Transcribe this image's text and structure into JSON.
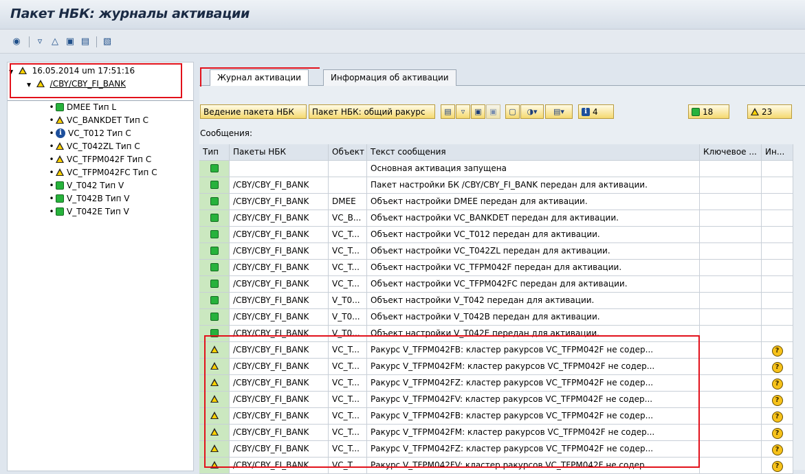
{
  "title": "Пакет НБК: журналы активации",
  "toolbar_icons": [
    "find-icon",
    "filter-icon",
    "collapse-icon",
    "expand-subtree-icon",
    "collapse-subtree-icon",
    "details-icon"
  ],
  "tree": {
    "root": "16.05.2014 um 17:51:16",
    "package": "/CBY/CBY_FI_BANK",
    "items": [
      {
        "label": "DMEE Тип L",
        "icon": "green-status-icon"
      },
      {
        "label": "VC_BANKDET Тип C",
        "icon": "warning-icon"
      },
      {
        "label": "VC_T012 Тип C",
        "icon": "info-icon"
      },
      {
        "label": "VC_T042ZL Тип C",
        "icon": "warning-icon"
      },
      {
        "label": "VC_TFPM042F Тип C",
        "icon": "warning-icon"
      },
      {
        "label": "VC_TFPM042FC Тип C",
        "icon": "warning-icon"
      },
      {
        "label": "V_T042 Тип V",
        "icon": "green-status-icon"
      },
      {
        "label": "V_T042B Тип V",
        "icon": "green-status-icon"
      },
      {
        "label": "V_T042E Тип V",
        "icon": "green-status-icon"
      }
    ]
  },
  "tabs": [
    "Журнал активации",
    "Информация об активации"
  ],
  "buttons": {
    "maintain": "Ведение пакета НБК",
    "overview": "Пакет НБК: общий ракурс",
    "info_count": "4",
    "success_count": "18",
    "warning_count": "23"
  },
  "messages_label": "Сообщения:",
  "columns": [
    "Тип",
    "Пакеты НБК",
    "Объект",
    "Текст сообщения",
    "Ключевое ...",
    "Ин..."
  ],
  "rows": [
    {
      "type": "green",
      "pkg": "",
      "obj": "",
      "text": "Основная активация запущена",
      "ltxt": ""
    },
    {
      "type": "green",
      "pkg": "/CBY/CBY_FI_BANK",
      "obj": "",
      "text": "Пакет настройки БК /CBY/CBY_FI_BANK передан для активации.",
      "ltxt": ""
    },
    {
      "type": "green",
      "pkg": "/CBY/CBY_FI_BANK",
      "obj": "DMEE",
      "text": "Объект настройки DMEE передан для активации.",
      "ltxt": ""
    },
    {
      "type": "green",
      "pkg": "/CBY/CBY_FI_BANK",
      "obj": "VC_B...",
      "text": "Объект настройки VC_BANKDET передан для активации.",
      "ltxt": ""
    },
    {
      "type": "green",
      "pkg": "/CBY/CBY_FI_BANK",
      "obj": "VC_T...",
      "text": "Объект настройки VC_T012 передан для активации.",
      "ltxt": ""
    },
    {
      "type": "green",
      "pkg": "/CBY/CBY_FI_BANK",
      "obj": "VC_T...",
      "text": "Объект настройки VC_T042ZL передан для активации.",
      "ltxt": ""
    },
    {
      "type": "green",
      "pkg": "/CBY/CBY_FI_BANK",
      "obj": "VC_T...",
      "text": "Объект настройки VC_TFPM042F передан для активации.",
      "ltxt": ""
    },
    {
      "type": "green",
      "pkg": "/CBY/CBY_FI_BANK",
      "obj": "VC_T...",
      "text": "Объект настройки VC_TFPM042FC передан для активации.",
      "ltxt": ""
    },
    {
      "type": "green",
      "pkg": "/CBY/CBY_FI_BANK",
      "obj": "V_T0...",
      "text": "Объект настройки V_T042 передан для активации.",
      "ltxt": ""
    },
    {
      "type": "green",
      "pkg": "/CBY/CBY_FI_BANK",
      "obj": "V_T0...",
      "text": "Объект настройки V_T042B передан для активации.",
      "ltxt": ""
    },
    {
      "type": "green",
      "pkg": "/CBY/CBY_FI_BANK",
      "obj": "V_T0...",
      "text": "Объект настройки V_T042E передан для активации.",
      "ltxt": ""
    },
    {
      "type": "warning",
      "pkg": "/CBY/CBY_FI_BANK",
      "obj": "VC_T...",
      "text": "Ракурс V_TFPM042FB: кластер ракурсов VC_TFPM042F не содер...",
      "ltxt": "help-icon"
    },
    {
      "type": "warning",
      "pkg": "/CBY/CBY_FI_BANK",
      "obj": "VC_T...",
      "text": "Ракурс V_TFPM042FM: кластер ракурсов VC_TFPM042F не содер...",
      "ltxt": "help-icon"
    },
    {
      "type": "warning",
      "pkg": "/CBY/CBY_FI_BANK",
      "obj": "VC_T...",
      "text": "Ракурс V_TFPM042FZ: кластер ракурсов VC_TFPM042F не содер...",
      "ltxt": "help-icon"
    },
    {
      "type": "warning",
      "pkg": "/CBY/CBY_FI_BANK",
      "obj": "VC_T...",
      "text": "Ракурс V_TFPM042FV: кластер ракурсов VC_TFPM042F не содер...",
      "ltxt": "help-icon"
    },
    {
      "type": "warning",
      "pkg": "/CBY/CBY_FI_BANK",
      "obj": "VC_T...",
      "text": "Ракурс V_TFPM042FB: кластер ракурсов VC_TFPM042F не содер...",
      "ltxt": "help-icon"
    },
    {
      "type": "warning",
      "pkg": "/CBY/CBY_FI_BANK",
      "obj": "VC_T...",
      "text": "Ракурс V_TFPM042FM: кластер ракурсов VC_TFPM042F не содер...",
      "ltxt": "help-icon"
    },
    {
      "type": "warning",
      "pkg": "/CBY/CBY_FI_BANK",
      "obj": "VC_T...",
      "text": "Ракурс V_TFPM042FZ: кластер ракурсов VC_TFPM042F не содер...",
      "ltxt": "help-icon"
    },
    {
      "type": "warning",
      "pkg": "/CBY/CBY_FI_BANK",
      "obj": "VC_T...",
      "text": "Ракурс V_TFPM042FV: кластер ракурсов VC_TFPM042F не содер...",
      "ltxt": "help-icon"
    }
  ],
  "colors": {
    "highlight": "#e2101a",
    "success": "#27b23c",
    "warning": "#ffd200",
    "button": "#f5d970"
  }
}
